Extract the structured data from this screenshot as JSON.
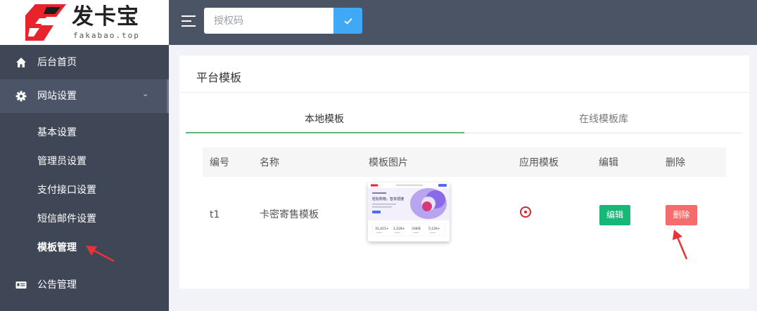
{
  "brand": {
    "name": "发卡宝",
    "domain": "fakabao.top",
    "logo_color": "#e8232c"
  },
  "topbar": {
    "search_placeholder": "授权码",
    "menu_icon": "hamburger-icon",
    "confirm_icon": "check-icon"
  },
  "sidebar": {
    "items": [
      {
        "label": "后台首页",
        "icon": "home-icon"
      },
      {
        "label": "网站设置",
        "icon": "gear-icon",
        "expanded": true
      }
    ],
    "sub_items": [
      {
        "label": "基本设置"
      },
      {
        "label": "管理员设置"
      },
      {
        "label": "支付接口设置"
      },
      {
        "label": "短信邮件设置"
      },
      {
        "label": "模板管理",
        "active": true
      }
    ],
    "bottom_items": [
      {
        "label": "公告管理",
        "icon": "news-icon"
      }
    ]
  },
  "card": {
    "title": "平台模板",
    "tabs": [
      {
        "label": "本地模板",
        "active": true
      },
      {
        "label": "在线模板库",
        "active": false
      }
    ],
    "table": {
      "headers": [
        "编号",
        "名称",
        "模板图片",
        "应用模板",
        "编辑",
        "删除"
      ],
      "rows": [
        {
          "id": "t1",
          "name": "卡密寄售模板",
          "applied": true,
          "edit_label": "编辑",
          "delete_label": "删除"
        }
      ]
    }
  },
  "thumbnail": {
    "headline": "轻松购物，智享便捷",
    "stats": [
      "31,421+",
      "1,228+",
      "338天",
      "5,126+"
    ]
  },
  "colors": {
    "sidebar": "#3f4757",
    "topbar": "#4b5465",
    "accent": "#3fa9f5",
    "green": "#16b777",
    "red": "#f56c6c",
    "tab_active": "#5fb878",
    "annotation": "#e8323a"
  }
}
